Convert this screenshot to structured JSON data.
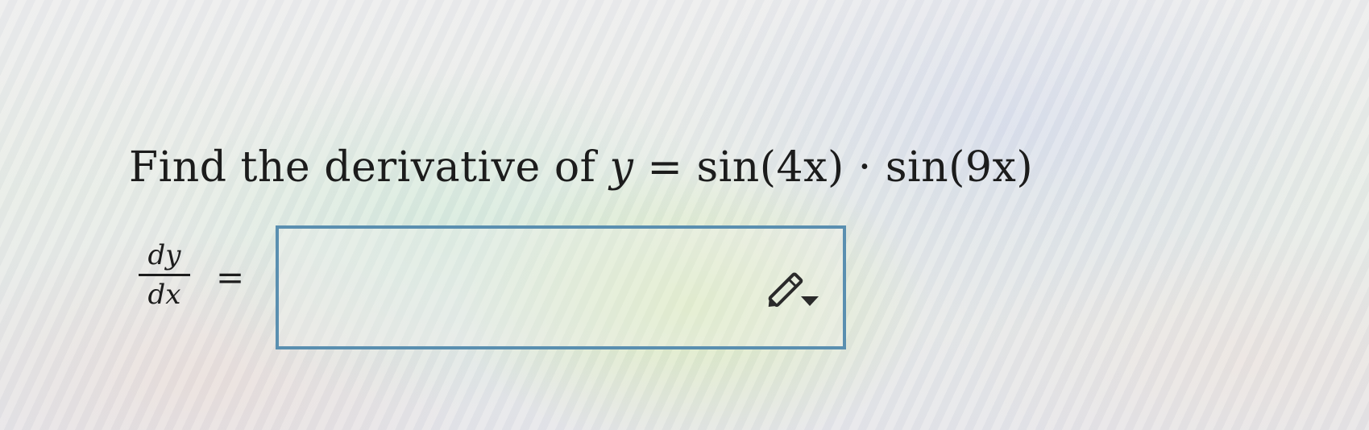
{
  "question": {
    "prefix": "Find the derivative of ",
    "equation_lhs": "y",
    "equation_rhs": " = sin(4x) · sin(9x)"
  },
  "answer": {
    "derivative_numerator": "dy",
    "derivative_denominator": "dx",
    "equals_sign": "=",
    "input_value": "",
    "editor_icon": "pencil-dropdown-icon"
  }
}
